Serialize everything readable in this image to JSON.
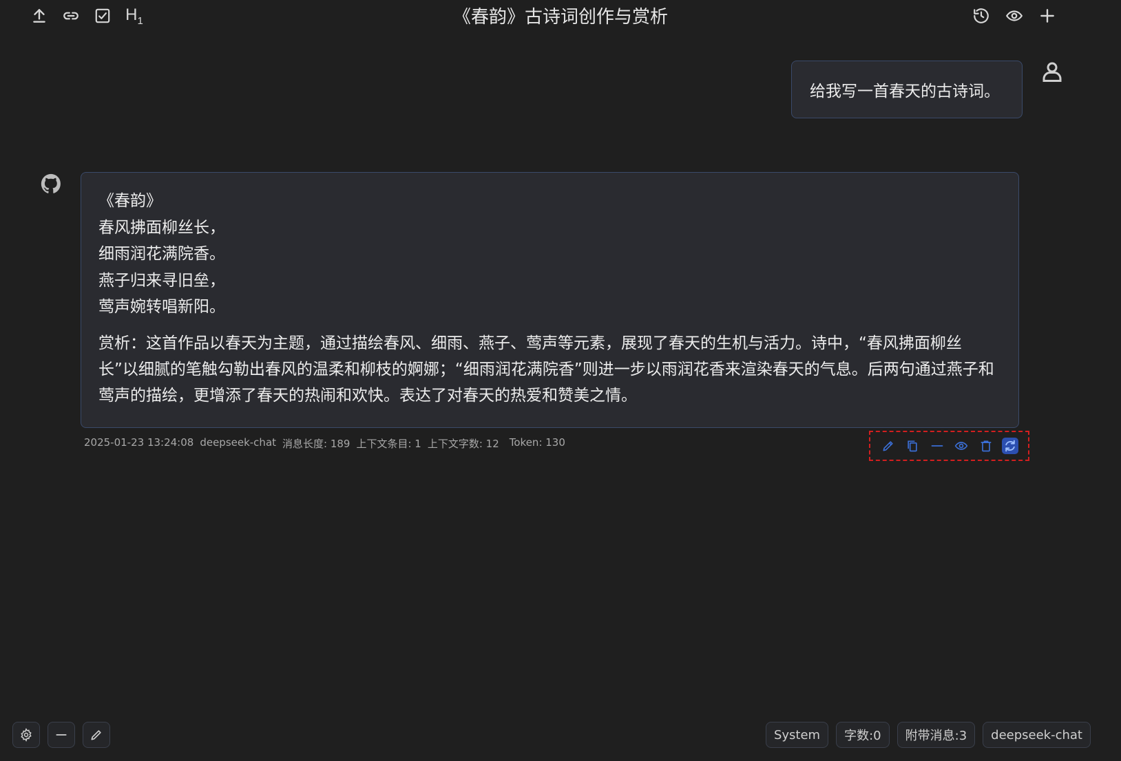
{
  "header": {
    "title": "《春韵》古诗词创作与赏析",
    "left_icons": [
      "upload-icon",
      "link-icon",
      "checkbox-icon",
      "heading-icon"
    ],
    "heading_label": "H",
    "heading_sub": "1",
    "right_icons": [
      "history-icon",
      "eye-icon",
      "plus-icon"
    ]
  },
  "user_message": {
    "text": "给我写一首春天的古诗词。"
  },
  "assistant_message": {
    "poem": [
      "《春韵》",
      "春风拂面柳丝长，",
      "细雨润花满院香。",
      "燕子归来寻旧垒，",
      "莺声婉转唱新阳。"
    ],
    "analysis": "赏析：这首作品以春天为主题，通过描绘春风、细雨、燕子、莺声等元素，展现了春天的生机与活力。诗中，“春风拂面柳丝长”以细腻的笔触勾勒出春风的温柔和柳枝的婀娜；“细雨润花满院香”则进一步以雨润花香来渲染春天的气息。后两句通过燕子和莺声的描绘，更增添了春天的热闹和欢快。表达了对春天的热爱和赞美之情。",
    "meta": {
      "timestamp": "2025-01-23 13:24:08",
      "model": "deepseek-chat",
      "length": "消息长度: 189",
      "context_items": "上下文条目: 1",
      "context_chars": "上下文字数: 12",
      "tokens": "Token: 130"
    },
    "actions": [
      "edit-icon",
      "copy-icon",
      "collapse-icon",
      "eye-icon",
      "delete-icon",
      "refresh-icon"
    ]
  },
  "footer": {
    "left_icons": [
      "settings-icon",
      "minus-icon",
      "pencil-icon"
    ],
    "system_label": "System",
    "char_count": "字数:0",
    "attached_messages": "附带消息:3",
    "model": "deepseek-chat"
  },
  "colors": {
    "background": "#1f1f1f",
    "bubble": "#2a2b30",
    "bubble_border": "#3a4a6a",
    "action_blue": "#3b6fd6",
    "highlight_red": "#d21f1f"
  }
}
